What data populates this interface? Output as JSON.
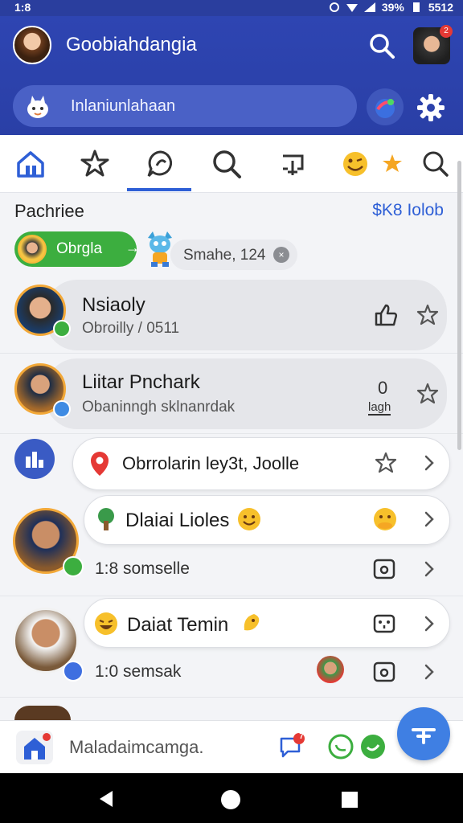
{
  "status_bar": {
    "time": "1:8",
    "battery": "39%",
    "signal_text": "5512"
  },
  "header": {
    "title": "Goobiahdangia",
    "search_placeholder": "Inlaniunlahaan",
    "avatar_badge": "2"
  },
  "tabs": [
    {
      "icon": "home-icon"
    },
    {
      "icon": "star-icon"
    },
    {
      "icon": "chat-icon",
      "active": true
    },
    {
      "icon": "search-heart-icon"
    },
    {
      "icon": "share-icon"
    },
    {
      "icon": "emoji-icon"
    },
    {
      "icon": "star-filled-icon"
    },
    {
      "icon": "search-icon"
    }
  ],
  "section": {
    "title": "Pachriee",
    "link": "$K8 Iolob"
  },
  "chips": {
    "green_label": "Obrgla",
    "green_arrow": "→",
    "grey_label": "Smahe, 124",
    "grey_close": "×"
  },
  "contacts": [
    {
      "name": "Nsiaoly",
      "sub": "Obroilly / 0511"
    },
    {
      "name": "Liitar Pnchark",
      "sub": "Obaninngh sklnanrdak",
      "side_label": "lagh",
      "side_digit": "0"
    },
    {
      "bubble": "Obrrolarin  ley3t, Joolle"
    },
    {
      "bubble": "Dlaiai Lioles",
      "sub": "1:8  somselle"
    },
    {
      "bubble": "Daiat Temin",
      "sub": "1:0  semsak"
    }
  ],
  "bottom": {
    "compose_placeholder": "Maladaimcamga.",
    "badge": "7"
  },
  "colors": {
    "primary": "#2e45b2",
    "accent": "#2e5fd6",
    "green": "#3cae3f",
    "fab": "#3f7fe3"
  }
}
